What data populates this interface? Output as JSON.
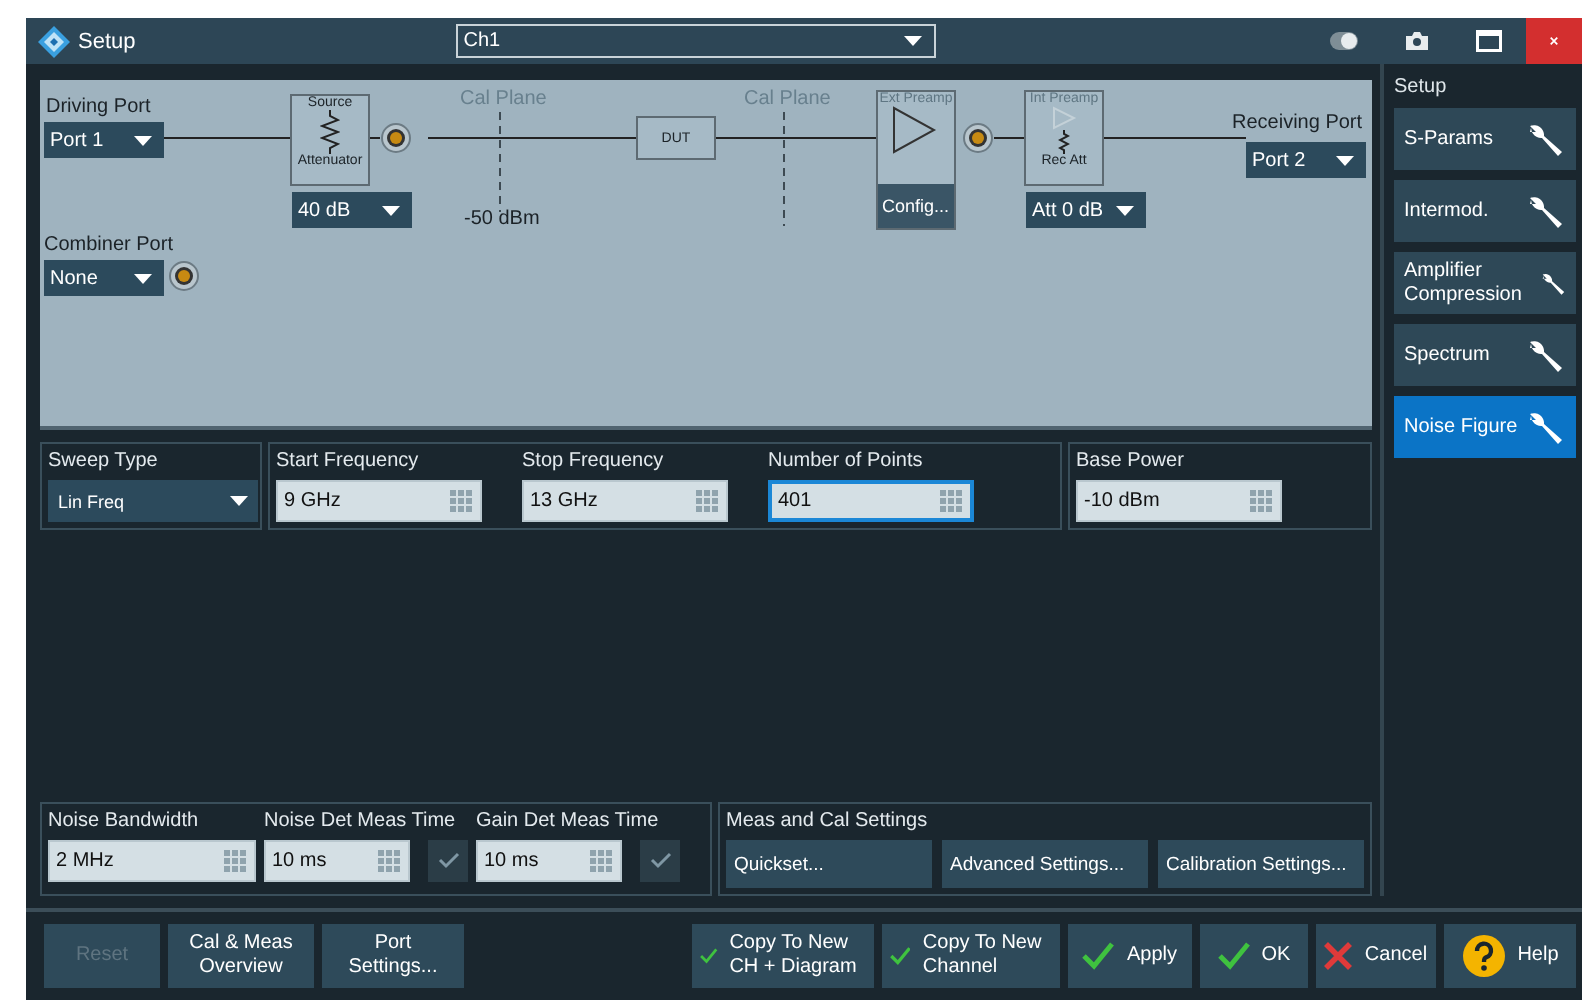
{
  "window": {
    "title": "Setup",
    "channel": "Ch1"
  },
  "diagram": {
    "driving_port": {
      "label": "Driving Port",
      "value": "Port 1"
    },
    "source": {
      "title": "Source",
      "subtitle": "Attenuator",
      "value": "40 dB"
    },
    "cal_planes": [
      {
        "label": "Cal Plane",
        "reading": "-50 dBm"
      },
      {
        "label": "Cal Plane"
      }
    ],
    "dut": "DUT",
    "ext_preamp": {
      "label": "Ext Preamp",
      "button": "Config..."
    },
    "int_preamp": {
      "label": "Int Preamp",
      "sublabel": "Rec Att",
      "value": "Att 0 dB"
    },
    "receiving_port": {
      "label": "Receiving Port",
      "value": "Port 2"
    },
    "combiner_port": {
      "label": "Combiner Port",
      "value": "None"
    }
  },
  "sweep": {
    "sweep_type": {
      "label": "Sweep Type",
      "value": "Lin Freq"
    },
    "fields": [
      {
        "label": "Start Frequency",
        "value": "9 GHz",
        "focused": false
      },
      {
        "label": "Stop Frequency",
        "value": "13 GHz",
        "focused": false
      },
      {
        "label": "Number of Points",
        "value": "401",
        "focused": true
      }
    ],
    "base_power": {
      "label": "Base Power",
      "value": "-10 dBm",
      "focused": false
    }
  },
  "noise": {
    "fields": [
      {
        "label": "Noise Bandwidth",
        "value": "2 MHz"
      },
      {
        "label": "Noise Det Meas Time",
        "value": "10 ms",
        "checked": true
      },
      {
        "label": "Gain Det Meas Time",
        "value": "10 ms",
        "checked": true
      }
    ]
  },
  "meas_cal": {
    "label": "Meas and Cal Settings",
    "buttons": [
      "Quickset...",
      "Advanced Settings...",
      "Calibration Settings..."
    ]
  },
  "sidebar": {
    "title": "Setup",
    "items": [
      {
        "label": "S-Params",
        "selected": false
      },
      {
        "label": "Intermod.",
        "selected": false
      },
      {
        "label": "Amplifier Compression",
        "selected": false
      },
      {
        "label": "Spectrum",
        "selected": false
      },
      {
        "label": "Noise Figure",
        "selected": true
      }
    ]
  },
  "left_buttons": [
    {
      "label": "Reset",
      "disabled": true
    },
    {
      "label": "Cal & Meas Overview",
      "disabled": false
    },
    {
      "label": "Port Settings...",
      "disabled": false
    }
  ],
  "right_buttons": [
    {
      "label": "Copy To New CH + Diagram",
      "kind": "check"
    },
    {
      "label": "Copy To New Channel",
      "kind": "check"
    },
    {
      "label": "Apply",
      "kind": "check"
    },
    {
      "label": "OK",
      "kind": "check"
    },
    {
      "label": "Cancel",
      "kind": "cross"
    },
    {
      "label": "Help",
      "kind": "help"
    }
  ]
}
